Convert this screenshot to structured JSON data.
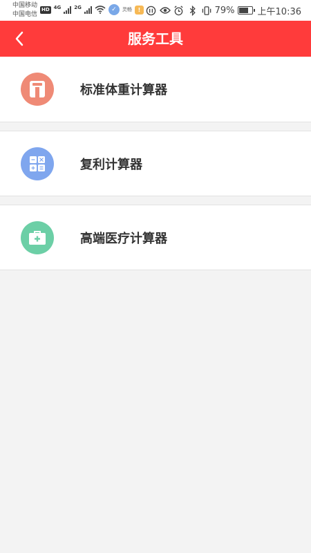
{
  "status_bar": {
    "carrier_1": "中国移动",
    "carrier_2": "中国电信",
    "hd": "HD",
    "net_1": "4G",
    "net_2": "2G",
    "app_small_text": "灵畅",
    "battery_percent": "79%",
    "battery_level": 0.79,
    "time": "上午10:36",
    "icons": [
      "hd-icon",
      "signal-icon",
      "signal-icon",
      "wifi-icon",
      "app-icon",
      "app-icon",
      "data-saver-icon",
      "eye-icon",
      "alarm-icon",
      "bluetooth-icon",
      "vibrate-icon",
      "battery-icon"
    ]
  },
  "header": {
    "title": "服务工具",
    "background": "#ff3b3b",
    "back_icon": "chevron-left-icon"
  },
  "tools": [
    {
      "label": "标准体重计算器",
      "icon": "scale-icon",
      "color": "#ef8a76"
    },
    {
      "label": "复利计算器",
      "icon": "calculator-icon",
      "color": "#7fa6ee"
    },
    {
      "label": "高端医疗计算器",
      "icon": "medical-kit-icon",
      "color": "#6ccfa6"
    }
  ]
}
